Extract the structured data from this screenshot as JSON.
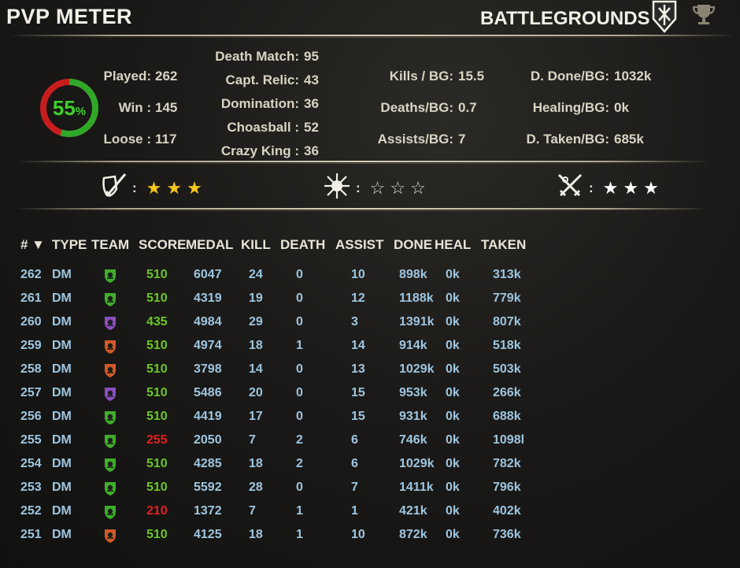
{
  "header": {
    "title": "PVP METER",
    "mode": "BATTLEGROUNDS"
  },
  "summary": {
    "win_percent": "55",
    "percent_sign": "%",
    "win_fraction": 0.55,
    "played_label": "Played:",
    "played": "262",
    "win_label": "Win :",
    "win": "145",
    "loose_label": "Loose :",
    "loose": "117"
  },
  "modes": [
    {
      "label": "Death Match:",
      "value": "95"
    },
    {
      "label": "Capt. Relic:",
      "value": "43"
    },
    {
      "label": "Domination:",
      "value": "36"
    },
    {
      "label": "Choasball :",
      "value": "52"
    },
    {
      "label": "Crazy King :",
      "value": "36"
    }
  ],
  "averages_left": [
    {
      "label": "Kills / BG:",
      "value": "15.5"
    },
    {
      "label": "Deaths/BG:",
      "value": "0.7"
    },
    {
      "label": "Assists/BG:",
      "value": "7"
    }
  ],
  "averages_right": [
    {
      "label": "D. Done/BG:",
      "value": "1032k"
    },
    {
      "label": "Healing/BG:",
      "value": "0k"
    },
    {
      "label": "D. Taken/BG:",
      "value": "685k"
    }
  ],
  "ratings": [
    {
      "icon": "sword-shield-icon",
      "colon": ":",
      "stars": 3,
      "style": "gold"
    },
    {
      "icon": "burst-icon",
      "colon": ":",
      "stars": 0,
      "style": "empty"
    },
    {
      "icon": "crossed-swords-icon",
      "colon": ":",
      "stars": 3,
      "style": "white"
    }
  ],
  "colors": {
    "green_team": "#3fae2a",
    "purple_team": "#8a4fc0",
    "orange_team": "#d05a28",
    "score_green": "#6cc62a",
    "score_red": "#e02020"
  },
  "table": {
    "headers": [
      "# ▼",
      "TYPE",
      "TEAM",
      "SCORE",
      "MEDAL",
      "KILL",
      "DEATH",
      "ASSIST",
      "DONE",
      "HEAL",
      "TAKEN"
    ],
    "rows": [
      {
        "id": "262",
        "type": "DM",
        "team": "green",
        "score": "510",
        "medal": "6047",
        "kill": "24",
        "death": "0",
        "assist": "10",
        "done": "898k",
        "heal": "0k",
        "taken": "313k",
        "score_color": "green"
      },
      {
        "id": "261",
        "type": "DM",
        "team": "green",
        "score": "510",
        "medal": "4319",
        "kill": "19",
        "death": "0",
        "assist": "12",
        "done": "1188k",
        "heal": "0k",
        "taken": "779k",
        "score_color": "green"
      },
      {
        "id": "260",
        "type": "DM",
        "team": "purple",
        "score": "435",
        "medal": "4984",
        "kill": "29",
        "death": "0",
        "assist": "3",
        "done": "1391k",
        "heal": "0k",
        "taken": "807k",
        "score_color": "green"
      },
      {
        "id": "259",
        "type": "DM",
        "team": "orange",
        "score": "510",
        "medal": "4974",
        "kill": "18",
        "death": "1",
        "assist": "14",
        "done": "914k",
        "heal": "0k",
        "taken": "518k",
        "score_color": "green"
      },
      {
        "id": "258",
        "type": "DM",
        "team": "orange",
        "score": "510",
        "medal": "3798",
        "kill": "14",
        "death": "0",
        "assist": "13",
        "done": "1029k",
        "heal": "0k",
        "taken": "503k",
        "score_color": "green"
      },
      {
        "id": "257",
        "type": "DM",
        "team": "purple",
        "score": "510",
        "medal": "5486",
        "kill": "20",
        "death": "0",
        "assist": "15",
        "done": "953k",
        "heal": "0k",
        "taken": "266k",
        "score_color": "green"
      },
      {
        "id": "256",
        "type": "DM",
        "team": "green",
        "score": "510",
        "medal": "4419",
        "kill": "17",
        "death": "0",
        "assist": "15",
        "done": "931k",
        "heal": "0k",
        "taken": "688k",
        "score_color": "green"
      },
      {
        "id": "255",
        "type": "DM",
        "team": "green",
        "score": "255",
        "medal": "2050",
        "kill": "7",
        "death": "2",
        "assist": "6",
        "done": "746k",
        "heal": "0k",
        "taken": "1098l",
        "score_color": "red"
      },
      {
        "id": "254",
        "type": "DM",
        "team": "green",
        "score": "510",
        "medal": "4285",
        "kill": "18",
        "death": "2",
        "assist": "6",
        "done": "1029k",
        "heal": "0k",
        "taken": "782k",
        "score_color": "green"
      },
      {
        "id": "253",
        "type": "DM",
        "team": "green",
        "score": "510",
        "medal": "5592",
        "kill": "28",
        "death": "0",
        "assist": "7",
        "done": "1411k",
        "heal": "0k",
        "taken": "796k",
        "score_color": "green"
      },
      {
        "id": "252",
        "type": "DM",
        "team": "green",
        "score": "210",
        "medal": "1372",
        "kill": "7",
        "death": "1",
        "assist": "1",
        "done": "421k",
        "heal": "0k",
        "taken": "402k",
        "score_color": "red"
      },
      {
        "id": "251",
        "type": "DM",
        "team": "orange",
        "score": "510",
        "medal": "4125",
        "kill": "18",
        "death": "1",
        "assist": "10",
        "done": "872k",
        "heal": "0k",
        "taken": "736k",
        "score_color": "green"
      }
    ]
  }
}
